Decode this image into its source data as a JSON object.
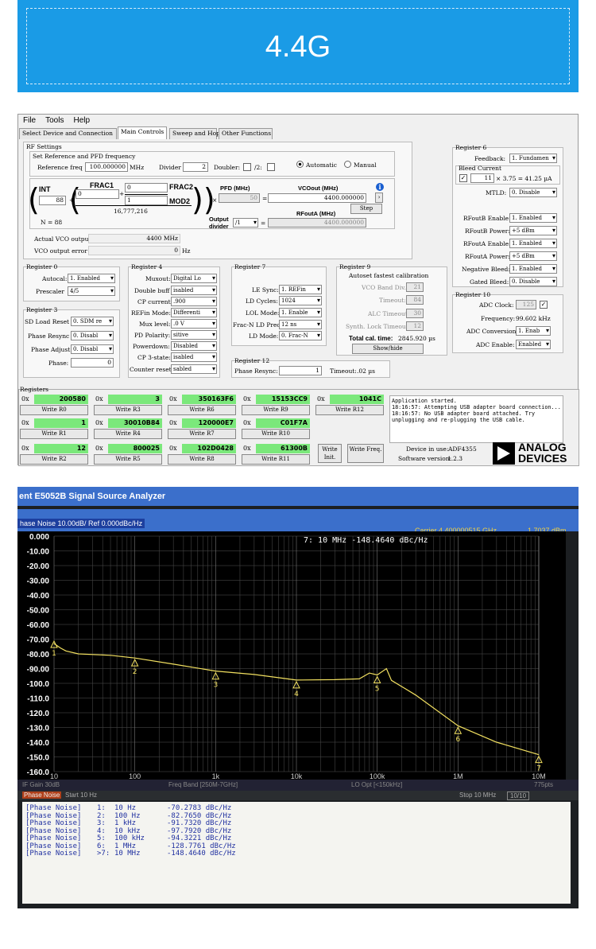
{
  "banner": {
    "title": "4.4G"
  },
  "menu": [
    "File",
    "Tools",
    "Help"
  ],
  "tabs": [
    "Select Device and Connection",
    "Main Controls",
    "Sweep and Hop",
    "Other Functions"
  ],
  "rf": {
    "group": "RF Settings",
    "ref_group": "Set Reference and PFD frequency",
    "ref_label": "Reference freq",
    "ref_val": "100.000000",
    "ref_unit": "MHz",
    "divider_label": "Divider",
    "divider_val": "2",
    "doubler_label": "Doubler:",
    "div2_label": "/2:",
    "auto_label": "Automatic",
    "manual_label": "Manual",
    "int_label": "INT",
    "int_val": "88",
    "n_label": "N = 88",
    "frac1_label": "FRAC1",
    "frac1_val": "0",
    "frac2_label": "FRAC2",
    "frac2_val": "0",
    "mod2_label": "MOD2",
    "mod2_val": "1",
    "mod1_const": "16,777,216",
    "pfd_label": "PFD (MHz)",
    "pfd_val": "50",
    "vcoout_label": "VCOout (MHz)",
    "vcoout_val": "4400.000000",
    "step_label": "Step",
    "outdiv_label": "Output divider",
    "outdiv_val": "/1",
    "rfouta_label": "RFoutA (MHz)",
    "rfouta_val": "4400.000000",
    "actual_vco_label": "Actual VCO output",
    "actual_vco_val": "4400 MHz",
    "vco_err_label": "VCO output error",
    "vco_err_val": "0",
    "vco_err_unit": "Hz"
  },
  "reg0": {
    "title": "Register 0",
    "autocal_label": "Autocal:",
    "autocal_val": "1. Enabled",
    "prescaler_label": "Prescaler",
    "prescaler_val": "4/5"
  },
  "reg3": {
    "title": "Register 3",
    "sd_label": "SD Load Reset",
    "sd_val": "0. SDM re",
    "phr_label": "Phase Resync",
    "phr_val": "0. Disabl",
    "pha_label": "Phase Adjust",
    "pha_val": "0. Disabl",
    "phase_label": "Phase:",
    "phase_val": "0"
  },
  "reg4": {
    "title": "Register 4",
    "muxout_label": "Muxout:",
    "muxout_val": "Digital Lo",
    "dbl_label": "Double buff",
    "dbl_val": "isabled",
    "cp_label": "CP current:",
    "cp_val": ".900",
    "refin_label": "REFin Mode:",
    "refin_val": "Differenti",
    "mux_label": "Mux level:",
    "mux_val": ".0 V",
    "pd_label": "PD Polarity:",
    "pd_val": "sitive",
    "pwr_label": "Powerdown:",
    "pwr_val": "Disabled",
    "cp3_label": "CP 3-state:",
    "cp3_val": "isabled",
    "ctr_label": "Counter reset:",
    "ctr_val": "sabled"
  },
  "reg7": {
    "title": "Register 7",
    "le_label": "LE Sync:",
    "le_val": "1. REFin",
    "ldc_label": "LD Cycles:",
    "ldc_val": "1024",
    "lol_label": "LOL Mode:",
    "lol_val": "1. Enable",
    "frac_label": "Frac-N LD Prec",
    "frac_val": "12 ns",
    "ldm_label": "LD Mode:",
    "ldm_val": "0. Frac-N"
  },
  "reg12": {
    "title": "Register 12",
    "resync_label": "Phase Resync:",
    "resync_val": "1",
    "timeout_label": "Timeout:",
    "timeout_val": ".02 µs"
  },
  "reg9": {
    "title": "Register 9",
    "subtitle": "Autoset fastest calibration",
    "vco_label": "VCO Band Div.",
    "vco_val": "21",
    "to_label": "Timeout:",
    "to_val": "84",
    "alc_label": "ALC Timeout:",
    "alc_val": "30",
    "synth_label": "Synth. Lock Timeout",
    "synth_val": "12",
    "total_label": "Total cal. time:",
    "total_val": "2845.920 µs",
    "show_label": "Show/hide"
  },
  "reg6": {
    "title": "Register 6",
    "fb_label": "Feedback:",
    "fb_val": "1. Fundamen",
    "bleed_label": "Bleed Current",
    "bleed_val": "11",
    "bleed_formula": "× 3.75 = 41.25 µA",
    "mtld_label": "MTLD:",
    "mtld_val": "0. Disable",
    "rfb_en_label": "RFoutB Enable:",
    "rfb_en_val": "1. Enabled",
    "rfb_pw_label": "RFoutB Power:",
    "rfb_pw_val": "+5 dBm",
    "rfa_en_label": "RFoutA Enable:",
    "rfa_en_val": "1. Enabled",
    "rfa_pw_label": "RFoutA Power:",
    "rfa_pw_val": "+5 dBm",
    "neg_label": "Negative Bleed:",
    "neg_val": "1. Enabled",
    "gated_label": "Gated Bleed:",
    "gated_val": "0. Disable"
  },
  "reg10": {
    "title": "Register 10",
    "adc_label": "ADC Clock:",
    "adc_val": "125",
    "freq_label": "Frequency:",
    "freq_val": "99.602 kHz",
    "conv_label": "ADC Conversion:",
    "conv_val": "1. Enab",
    "en_label": "ADC Enable:",
    "en_val": "Enabled"
  },
  "registers": {
    "title": "Registers",
    "prefix": "0x",
    "cells": [
      {
        "val": "200580",
        "btn": "Write R0"
      },
      {
        "val": "3",
        "btn": "Write R3"
      },
      {
        "val": "350163F6",
        "btn": "Write R6"
      },
      {
        "val": "15153CC9",
        "btn": "Write R9"
      },
      {
        "val": "1041C",
        "btn": "Write R12"
      },
      {
        "val": "1",
        "btn": "Write R1"
      },
      {
        "val": "30010B84",
        "btn": "Write R4"
      },
      {
        "val": "120000E7",
        "btn": "Write R7"
      },
      {
        "val": "C01F7A",
        "btn": "Write R10"
      },
      {
        "val": "12",
        "btn": "Write R2"
      },
      {
        "val": "800025",
        "btn": "Write R5"
      },
      {
        "val": "102D0428",
        "btn": "Write R8"
      },
      {
        "val": "61300B",
        "btn": "Write R11"
      }
    ],
    "write_init": "Write Init.",
    "write_freq": "Write Freq."
  },
  "log": "Application started.\n18:16:57: Attempting USB adapter board connection...\n18:16:57: No USB adapter board attached. Try\nunplugging and re-plugging the USB cable.",
  "device_label": "Device in use:",
  "device_val": "ADF4355",
  "software_label": "Software version:",
  "software_val": "1.2.3",
  "logo": {
    "line1": "ANALOG",
    "line2": "DEVICES"
  },
  "analyzer": {
    "title": "ent E5052B Signal Source Analyzer",
    "trace_title": "hase Noise 10.00dB/ Ref 0.000dBc/Hz",
    "carrier": "Carrier 4.400000515 GHz",
    "carrier_pwr": "1.7037 dBm",
    "marker_readout": "7:  10 MHz  -148.4640 dBc/Hz",
    "yticks": [
      "0.000",
      "-10.00",
      "-20.00",
      "-30.00",
      "-40.00",
      "-50.00",
      "-60.00",
      "-70.00",
      "-80.00",
      "-90.00",
      "-100.0",
      "-110.0",
      "-120.0",
      "-130.0",
      "-140.0",
      "-150.0",
      "-160.0"
    ],
    "xticks": [
      "10",
      "100",
      "1k",
      "10k",
      "100k",
      "1M",
      "10M"
    ],
    "status": [
      "IF Gain 30dB",
      "Freq Band [250M-7GHz]",
      "LO Opt [<150kHz]",
      "775pts"
    ],
    "start": "Start 10 Hz",
    "stop": "Stop 10 MHz",
    "tab": "Phase Noise",
    "page": "10/10",
    "markers": [
      {
        "id": "1:",
        "freq": "10 Hz",
        "val": "-70.2783 dBc/Hz"
      },
      {
        "id": "2:",
        "freq": "100 Hz",
        "val": "-82.7650 dBc/Hz"
      },
      {
        "id": "3:",
        "freq": "1 kHz",
        "val": "-91.7320 dBc/Hz"
      },
      {
        "id": "4:",
        "freq": "10 kHz",
        "val": "-97.7920 dBc/Hz"
      },
      {
        "id": "5:",
        "freq": "100 kHz",
        "val": "-94.3221 dBc/Hz"
      },
      {
        "id": "6:",
        "freq": "1 MHz",
        "val": "-128.7761 dBc/Hz"
      },
      {
        "id": ">7:",
        "freq": "10 MHz",
        "val": "-148.4640 dBc/Hz"
      }
    ],
    "marker_prefix": "[Phase Noise]",
    "marker_ids": [
      "1",
      "2",
      "3",
      "4",
      "5",
      "6",
      "7"
    ]
  }
}
